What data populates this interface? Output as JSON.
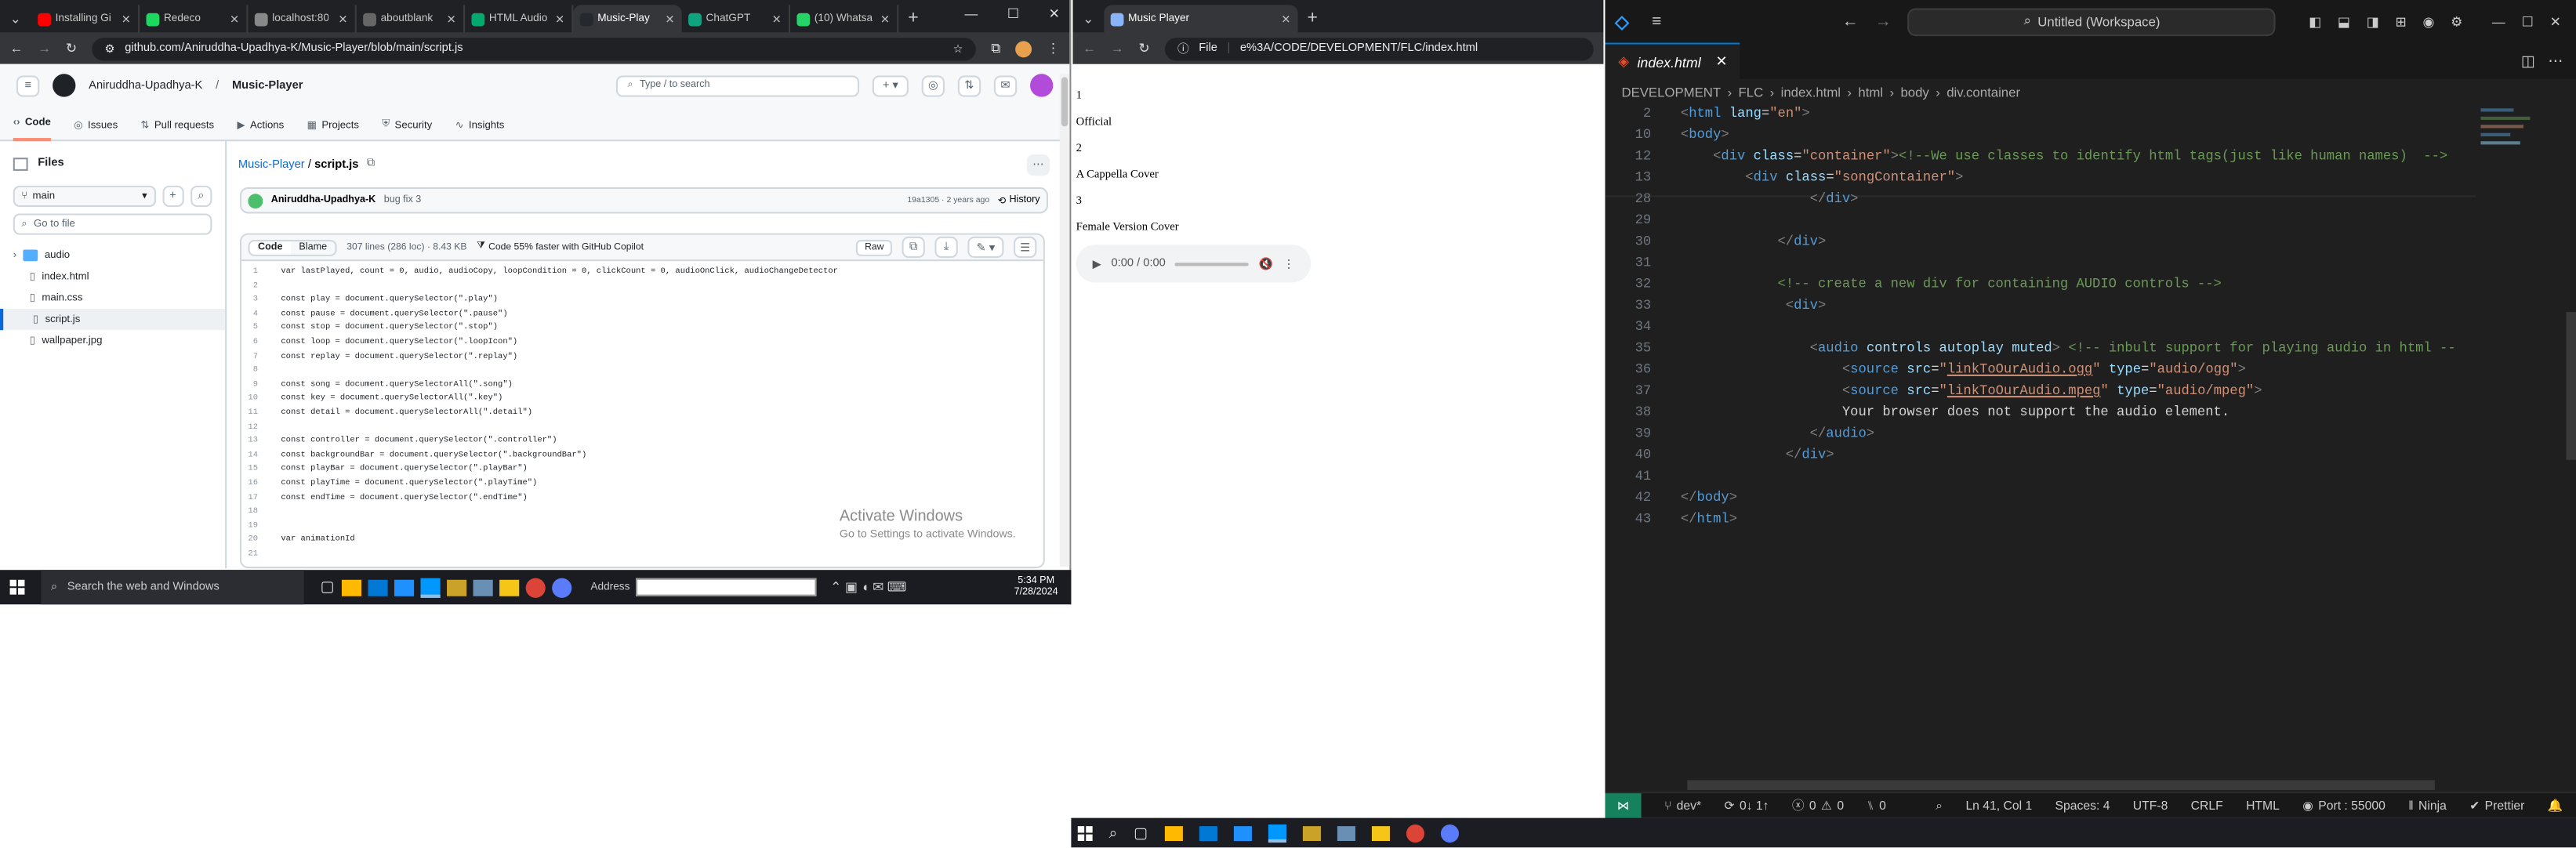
{
  "browser1": {
    "tabs": [
      {
        "title": "Installing Gi",
        "color": "#ff0000"
      },
      {
        "title": "Redeco",
        "color": "#1ed760"
      },
      {
        "title": "localhost:80",
        "color": "#888888"
      },
      {
        "title": "aboutblank",
        "color": "#666666"
      },
      {
        "title": "HTML Audio",
        "color": "#04aa6d"
      },
      {
        "title": "Music-Play",
        "color": "#24292f",
        "active": true
      },
      {
        "title": "ChatGPT",
        "color": "#10a37f"
      },
      {
        "title": "(10) Whatsa",
        "color": "#25d366"
      }
    ],
    "url": "github.com/Aniruddha-Upadhya-K/Music-Player/blob/main/script.js",
    "owner": "Aniruddha-Upadhya-K",
    "repo": "Music-Player",
    "search_placeholder": "Type / to search",
    "nav": [
      "Code",
      "Issues",
      "Pull requests",
      "Actions",
      "Projects",
      "Security",
      "Insights"
    ],
    "files_title": "Files",
    "branch": "main",
    "goto_placeholder": "Go to file",
    "tree": [
      {
        "name": "audio",
        "type": "folder"
      },
      {
        "name": "index.html",
        "type": "file"
      },
      {
        "name": "main.css",
        "type": "file"
      },
      {
        "name": "script.js",
        "type": "file",
        "selected": true
      },
      {
        "name": "wallpaper.jpg",
        "type": "file"
      }
    ],
    "breadcrumb_repo": "Music-Player",
    "breadcrumb_file": "script.js",
    "commit_author": "Aniruddha-Upadhya-K",
    "commit_msg": "bug fix 3",
    "commit_meta": "19a1305 · 2 years ago",
    "history_label": "History",
    "code_tab": "Code",
    "blame_tab": "Blame",
    "file_info": "307 lines (286 loc) · 8.43 KB",
    "copilot_label": "Code 55% faster with GitHub Copilot",
    "raw_label": "Raw",
    "code_lines": [
      "var lastPlayed, count = 0, audio, audioCopy, loopCondition = 0, clickCount = 0, audioOnClick, audioChangeDetector",
      "",
      "const play = document.querySelector(\".play\")",
      "const pause = document.querySelector(\".pause\")",
      "const stop = document.querySelector(\".stop\")",
      "const loop = document.querySelector(\".loopIcon\")",
      "const replay = document.querySelector(\".replay\")",
      "",
      "const song = document.querySelectorAll(\".song\")",
      "const key = document.querySelectorAll(\".key\")",
      "const detail = document.querySelectorAll(\".detail\")",
      "",
      "const controller = document.querySelector(\".controller\")",
      "const backgroundBar = document.querySelector(\".backgroundBar\")",
      "const playBar = document.querySelector(\".playBar\")",
      "const playTime = document.querySelector(\".playTime\")",
      "const endTime = document.querySelector(\".endTime\")",
      "",
      "",
      "var animationId",
      ""
    ],
    "watermark_title": "Activate Windows",
    "watermark_sub": "Go to Settings to activate Windows."
  },
  "taskbar1": {
    "search_placeholder": "Search the web and Windows",
    "address_label": "Address",
    "time": "5:34 PM",
    "date": "7/28/2024"
  },
  "browser2": {
    "tab_title": "Music Player",
    "url_prefix": "File",
    "url": "e%3A/CODE/DEVELOPMENT/FLC/index.html",
    "content": [
      "1",
      "Official",
      "2",
      "A Cappella Cover",
      "3",
      "Female Version Cover"
    ],
    "audio_time": "0:00 / 0:00"
  },
  "vscode": {
    "search_text": "Untitled (Workspace)",
    "tab_title": "index.html",
    "breadcrumb": [
      "DEVELOPMENT",
      "FLC",
      "index.html",
      "html",
      "body",
      "div.container"
    ],
    "status": {
      "branch": "dev*",
      "sync": "0↓ 1↑",
      "errors": "0",
      "warnings": "0",
      "ports_count": "0",
      "cursor": "Ln 41, Col 1",
      "spaces": "Spaces: 4",
      "encoding": "UTF-8",
      "eol": "CRLF",
      "language": "HTML",
      "port": "Port : 55000",
      "ninja": "Ninja",
      "prettier": "Prettier"
    },
    "sticky_lines": [
      {
        "n": "2",
        "html": "<span class=\"p\">&lt;</span><span class=\"t\">html</span> <span class=\"a\">lang</span><span class=\"w\">=</span><span class=\"s\">\"en\"</span><span class=\"p\">&gt;</span>"
      },
      {
        "n": "10",
        "html": "<span class=\"p\">&lt;</span><span class=\"t\">body</span><span class=\"p\">&gt;</span>"
      },
      {
        "n": "12",
        "html": "    <span class=\"p\">&lt;</span><span class=\"t\">div</span> <span class=\"a\">class</span><span class=\"w\">=</span><span class=\"s\">\"container\"</span><span class=\"p\">&gt;</span><span class=\"c\">&lt;!--We use classes to identify html tags(just like human names)  --&gt;</span>"
      },
      {
        "n": "13",
        "html": "        <span class=\"p\">&lt;</span><span class=\"t\">div</span> <span class=\"a\">class</span><span class=\"w\">=</span><span class=\"s\">\"songContainer\"</span><span class=\"p\">&gt;</span>"
      }
    ],
    "lines": [
      {
        "n": "28",
        "html": "                <span class=\"p\">&lt;/</span><span class=\"t\">div</span><span class=\"p\">&gt;</span>"
      },
      {
        "n": "29",
        "html": ""
      },
      {
        "n": "30",
        "html": "            <span class=\"p\">&lt;/</span><span class=\"t\">div</span><span class=\"p\">&gt;</span>"
      },
      {
        "n": "31",
        "html": ""
      },
      {
        "n": "32",
        "html": "            <span class=\"c\">&lt;!-- create a new div for containing AUDIO controls --&gt;</span>"
      },
      {
        "n": "33",
        "html": "             <span class=\"p\">&lt;</span><span class=\"t\">div</span><span class=\"p\">&gt;</span>"
      },
      {
        "n": "34",
        "html": ""
      },
      {
        "n": "35",
        "html": "                <span class=\"p\">&lt;</span><span class=\"t\">audio</span> <span class=\"a\">controls</span> <span class=\"a\">autoplay</span> <span class=\"a\">muted</span><span class=\"p\">&gt;</span> <span class=\"c\">&lt;!-- inbult support for playing audio in html --</span>"
      },
      {
        "n": "36",
        "html": "                    <span class=\"p\">&lt;</span><span class=\"t\">source</span> <span class=\"a\">src</span><span class=\"w\">=</span><span class=\"s\">\"<u>linkToOurAudio.ogg</u>\"</span> <span class=\"a\">type</span><span class=\"w\">=</span><span class=\"s\">\"audio/ogg\"</span><span class=\"p\">&gt;</span>"
      },
      {
        "n": "37",
        "html": "                    <span class=\"p\">&lt;</span><span class=\"t\">source</span> <span class=\"a\">src</span><span class=\"w\">=</span><span class=\"s\">\"<u>linkToOurAudio.mpeg</u>\"</span> <span class=\"a\">type</span><span class=\"w\">=</span><span class=\"s\">\"audio/mpeg\"</span><span class=\"p\">&gt;</span>"
      },
      {
        "n": "38",
        "html": "                    <span class=\"w\">Your browser does not support the audio element.</span>"
      },
      {
        "n": "39",
        "html": "                <span class=\"p\">&lt;/</span><span class=\"t\">audio</span><span class=\"p\">&gt;</span>"
      },
      {
        "n": "40",
        "html": "             <span class=\"p\">&lt;/</span><span class=\"t\">div</span><span class=\"p\">&gt;</span>"
      },
      {
        "n": "41",
        "html": ""
      },
      {
        "n": "42",
        "html": "<span class=\"p\">&lt;/</span><span class=\"t\">body</span><span class=\"p\">&gt;</span>"
      },
      {
        "n": "43",
        "html": "<span class=\"p\">&lt;/</span><span class=\"t\">html</span><span class=\"p\">&gt;</span>"
      }
    ]
  }
}
